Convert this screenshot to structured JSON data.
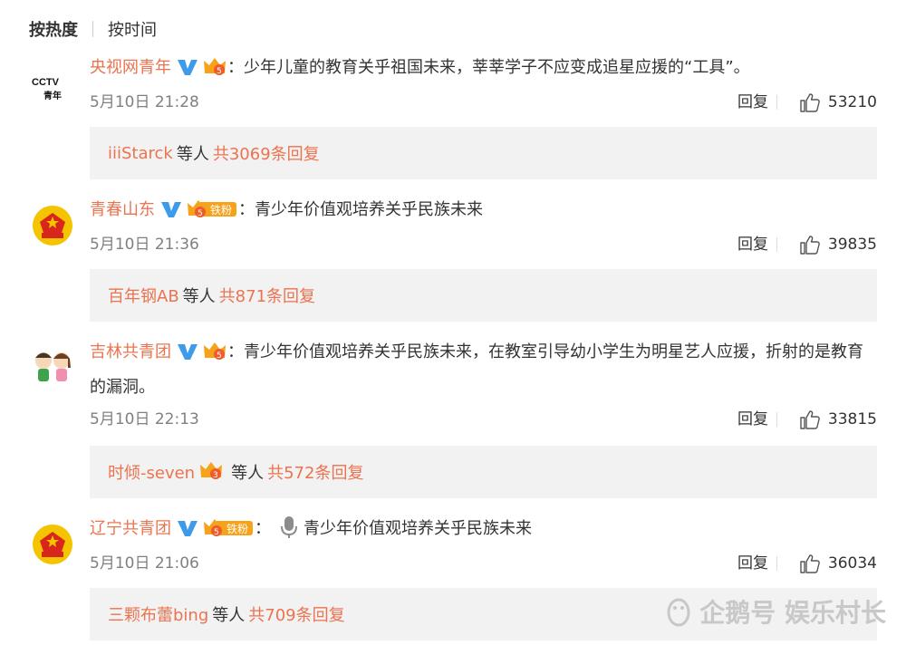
{
  "sort": {
    "active": "按热度",
    "inactive": "按时间"
  },
  "comments": [
    {
      "user": "央视网青年",
      "badge_text": "",
      "colon": "：",
      "text": "少年儿童的教育关乎祖国未来，莘莘学子不应变成追星应援的“工具”。",
      "time": "5月10日 21:28",
      "reply_label": "回复",
      "likes": "53210",
      "reply_user": "iiiStarck",
      "reply_mid": "等人",
      "reply_count": "共3069条回复",
      "avatar_text_top": "CCTV",
      "avatar_text_bottom": "青年"
    },
    {
      "user": "青春山东",
      "badge_text": "铁粉",
      "colon": "：",
      "text": "青少年价值观培养关乎民族未来",
      "time": "5月10日 21:36",
      "reply_label": "回复",
      "likes": "39835",
      "reply_user": "百年钢AB",
      "reply_mid": "等人",
      "reply_count": "共871条回复"
    },
    {
      "user": "吉林共青团",
      "badge_text": "",
      "colon": "：",
      "text": "青少年价值观培养关乎民族未来，在教室引导幼小学生为明星艺人应援，折射的是教育的漏洞。",
      "time": "5月10日 22:13",
      "reply_label": "回复",
      "likes": "33815",
      "reply_user": "时倾-seven",
      "reply_mid": "等人",
      "reply_count": "共572条回复"
    },
    {
      "user": "辽宁共青团",
      "badge_text": "铁粉",
      "colon": "：",
      "text": "青少年价值观培养关乎民族未来",
      "time": "5月10日 21:06",
      "reply_label": "回复",
      "likes": "36034",
      "reply_user": "三颗布蕾bing",
      "reply_mid": "等人",
      "reply_count": "共709条回复"
    }
  ],
  "watermark": "企鹅号 娱乐村长",
  "colors": {
    "username": "#eb7350",
    "verified": "#3d9be9",
    "badge": "#f7a21b",
    "reply_bg": "#f2f2f2"
  }
}
